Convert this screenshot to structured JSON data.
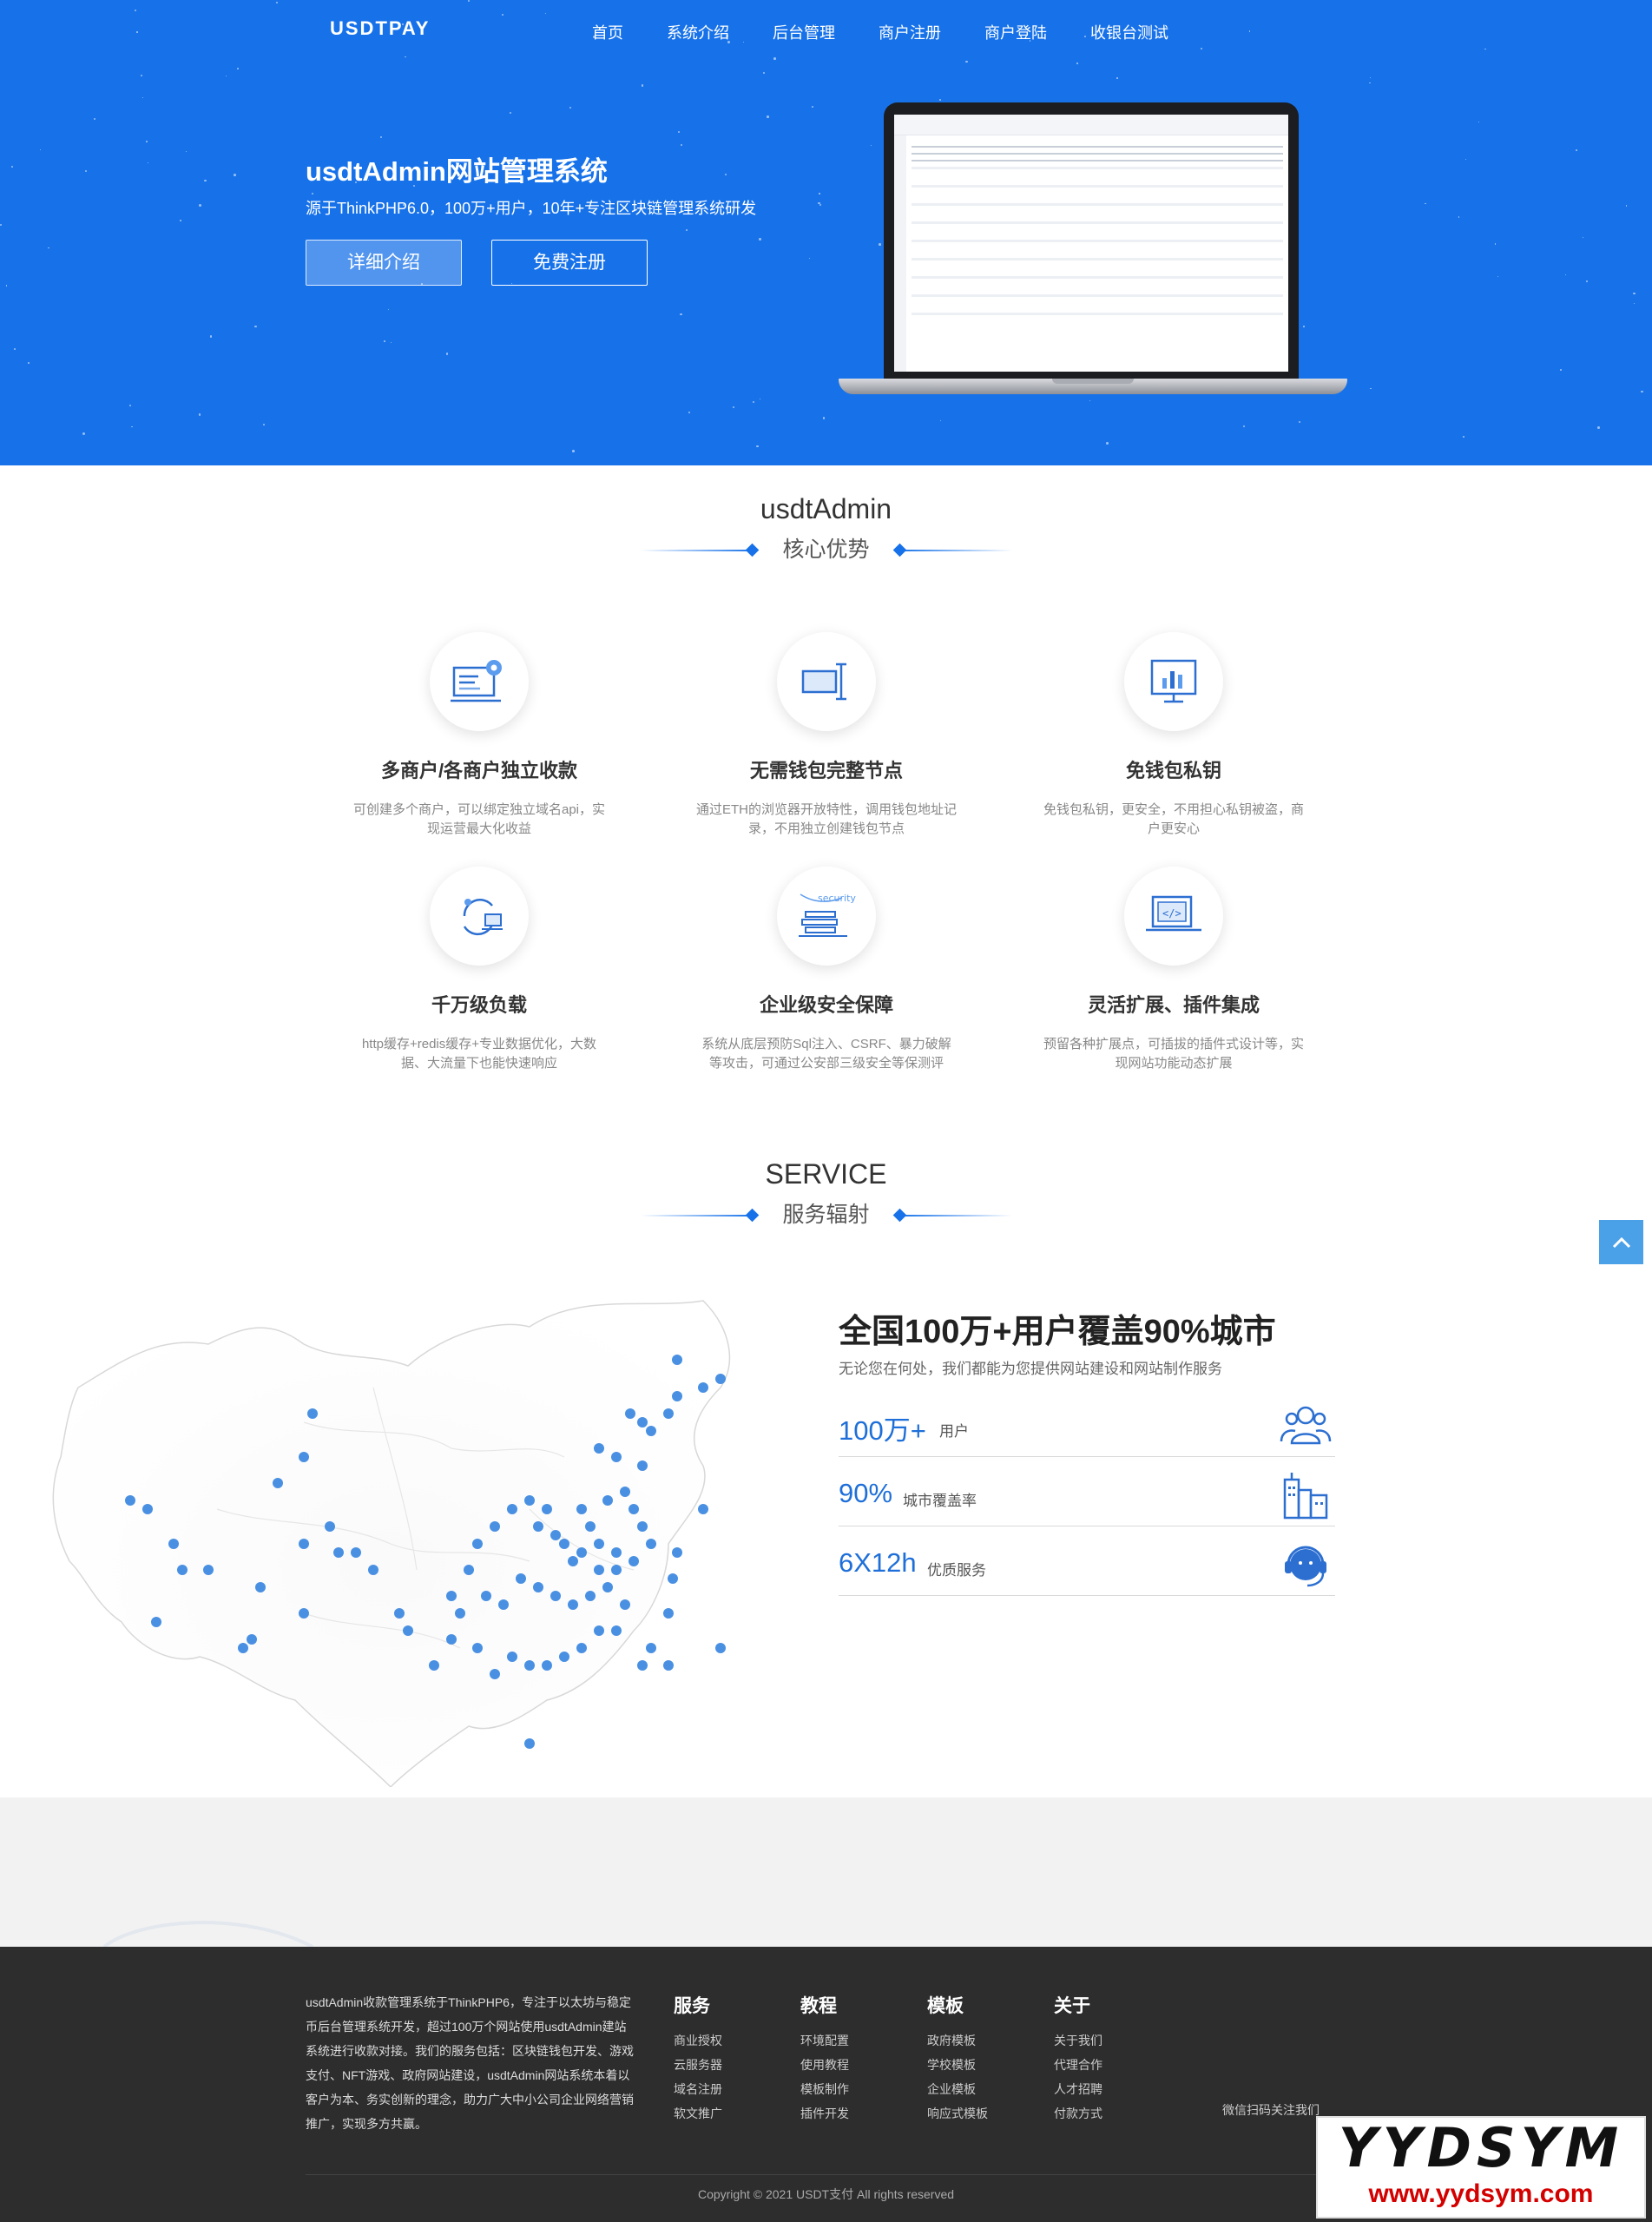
{
  "header": {
    "logo": "USDTPAY",
    "nav": [
      "首页",
      "系统介绍",
      "后台管理",
      "商户注册",
      "商户登陆",
      "收银台测试"
    ]
  },
  "hero": {
    "title": "usdtAdmin网站管理系统",
    "subtitle": "源于ThinkPHP6.0，100万+用户，10年+专注区块链管理系统研发",
    "btn_detail": "详细介绍",
    "btn_register": "免费注册"
  },
  "advantages": {
    "title": "usdtAdmin",
    "subtitle": "核心优势",
    "items": [
      {
        "title": "多商户/各商户独立收款",
        "desc": "可创建多个商户，可以绑定独立域名api，实现运营最大化收益",
        "icon": "merchant-settings-icon"
      },
      {
        "title": "无需钱包完整节点",
        "desc": "通过ETH的浏览器开放特性，调用钱包地址记录，不用独立创建钱包节点",
        "icon": "wallet-node-icon"
      },
      {
        "title": "免钱包私钥",
        "desc": "免钱包私钥，更安全，不用担心私钥被盗，商户更安心",
        "icon": "monitor-chart-icon"
      },
      {
        "title": "千万级负载",
        "desc": "http缓存+redis缓存+专业数据优化，大数据、大流量下也能快速响应",
        "icon": "load-sync-icon"
      },
      {
        "title": "企业级安全保障",
        "desc": "系统从底层预防Sql注入、CSRF、暴力破解等攻击，可通过公安部三级安全等保测评",
        "icon": "security-firewall-icon"
      },
      {
        "title": "灵活扩展、插件集成",
        "desc": "预留各种扩展点，可插拔的插件式设计等，实现网站功能动态扩展",
        "icon": "code-plugin-icon"
      }
    ]
  },
  "service": {
    "title": "SERVICE",
    "subtitle": "服务辐射",
    "headline": "全国100万+用户覆盖90%城市",
    "desc": "无论您在何处，我们都能为您提供网站建设和网站制作服务",
    "stats": [
      {
        "num": "100万+",
        "label": "用户",
        "icon": "users-icon"
      },
      {
        "num": "90%",
        "label": "城市覆盖率",
        "icon": "city-buildings-icon"
      },
      {
        "num": "6X12h",
        "label": "优质服务",
        "icon": "customer-service-icon"
      }
    ]
  },
  "footer": {
    "about": "usdtAdmin收款管理系统于ThinkPHP6，专注于以太坊与稳定币后台管理系统开发，超过100万个网站使用usdtAdmin建站系统进行收款对接。我们的服务包括：区块链钱包开发、游戏支付、NFT游戏、政府网站建设，usdtAdmin网站系统本着以客户为本、务实创新的理念，助力广大中小公司企业网络营销推广，实现多方共赢。",
    "columns": [
      {
        "title": "服务",
        "links": [
          "商业授权",
          "云服务器",
          "域名注册",
          "软文推广"
        ]
      },
      {
        "title": "教程",
        "links": [
          "环境配置",
          "使用教程",
          "模板制作",
          "插件开发"
        ]
      },
      {
        "title": "模板",
        "links": [
          "政府模板",
          "学校模板",
          "企业模板",
          "响应式模板"
        ]
      },
      {
        "title": "关于",
        "links": [
          "关于我们",
          "代理合作",
          "人才招聘",
          "付款方式"
        ]
      }
    ],
    "wechat": "微信扫码关注我们",
    "copyright": "Copyright © 2021 USDT支付 All rights reserved"
  },
  "watermark": {
    "brand": "YYDSYM",
    "url": "www.yydsym.com"
  },
  "colors": {
    "primary": "#1772ea",
    "footer_bg": "#2d2d2d",
    "map_dot": "#4a90e2"
  }
}
